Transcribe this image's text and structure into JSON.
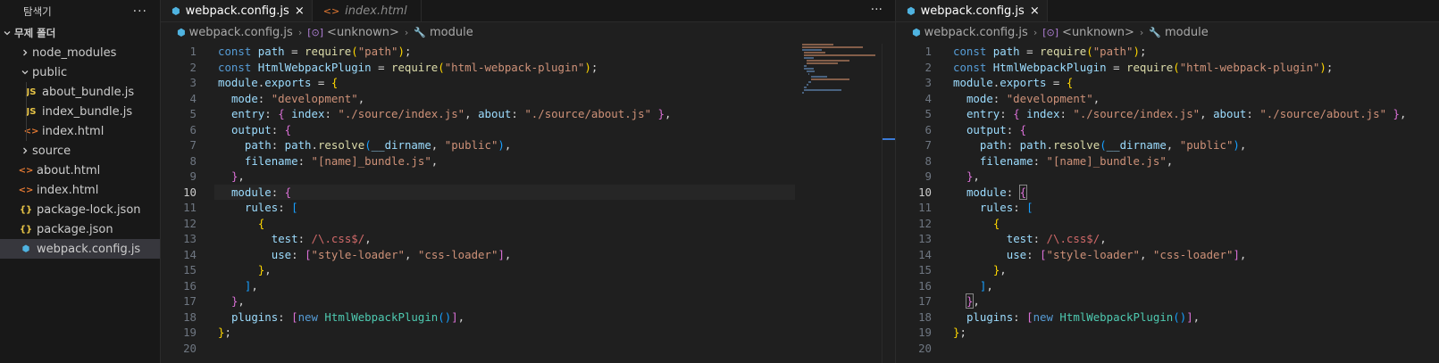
{
  "explorer": {
    "title": "탐색기",
    "more": "···",
    "root_folder": "무제 폴더",
    "items": [
      {
        "label": "node_modules",
        "type": "folder",
        "expanded": false,
        "depth": 1,
        "icon": "chevron-right-icon"
      },
      {
        "label": "public",
        "type": "folder",
        "expanded": true,
        "depth": 1,
        "icon": "chevron-down-icon"
      },
      {
        "label": "about_bundle.js",
        "type": "js",
        "depth": 2,
        "icon_text": "JS"
      },
      {
        "label": "index_bundle.js",
        "type": "js",
        "depth": 2,
        "icon_text": "JS"
      },
      {
        "label": "index.html",
        "type": "html",
        "depth": 2,
        "icon_text": "<>"
      },
      {
        "label": "source",
        "type": "folder",
        "expanded": false,
        "depth": 1,
        "icon": "chevron-right-icon"
      },
      {
        "label": "about.html",
        "type": "html",
        "depth": 1,
        "icon_text": "<>"
      },
      {
        "label": "index.html",
        "type": "html",
        "depth": 1,
        "icon_text": "<>"
      },
      {
        "label": "package-lock.json",
        "type": "json",
        "depth": 1,
        "icon_text": "{}"
      },
      {
        "label": "package.json",
        "type": "json",
        "depth": 1,
        "icon_text": "{}"
      },
      {
        "label": "webpack.config.js",
        "type": "webpack",
        "depth": 1,
        "icon_text": "⬢",
        "selected": true
      }
    ]
  },
  "left_editor": {
    "tabs": [
      {
        "label": "webpack.config.js",
        "active": true,
        "close": "×"
      },
      {
        "label": "index.html",
        "active": false
      }
    ],
    "more": "···",
    "breadcrumb": [
      "webpack.config.js",
      "<unknown>",
      "module"
    ],
    "current_line": 10
  },
  "right_editor": {
    "tabs": [
      {
        "label": "webpack.config.js",
        "active": true,
        "close": "×"
      }
    ],
    "breadcrumb": [
      "webpack.config.js",
      "<unknown>",
      "module"
    ],
    "current_line": 10
  },
  "code_lines": [
    "const path = require(\"path\");",
    "const HtmlWebpackPlugin = require(\"html-webpack-plugin\");",
    "module.exports = {",
    "  mode: \"development\",",
    "  entry: { index: \"./source/index.js\", about: \"./source/about.js\" },",
    "  output: {",
    "    path: path.resolve(__dirname, \"public\"),",
    "    filename: \"[name]_bundle.js\",",
    "  },",
    "  module: {",
    "    rules: [",
    "      {",
    "        test: /\\.css$/,",
    "        use: [\"style-loader\", \"css-loader\"],",
    "      },",
    "    ],",
    "  },",
    "  plugins: [new HtmlWebpackPlugin()],",
    "};",
    ""
  ],
  "colors": {
    "background": "#1f1f1f",
    "sidebar": "#181818",
    "keyword": "#569cd6",
    "string": "#ce9178",
    "function": "#dcdcaa",
    "variable": "#9cdcfe",
    "class": "#4ec9b0"
  }
}
